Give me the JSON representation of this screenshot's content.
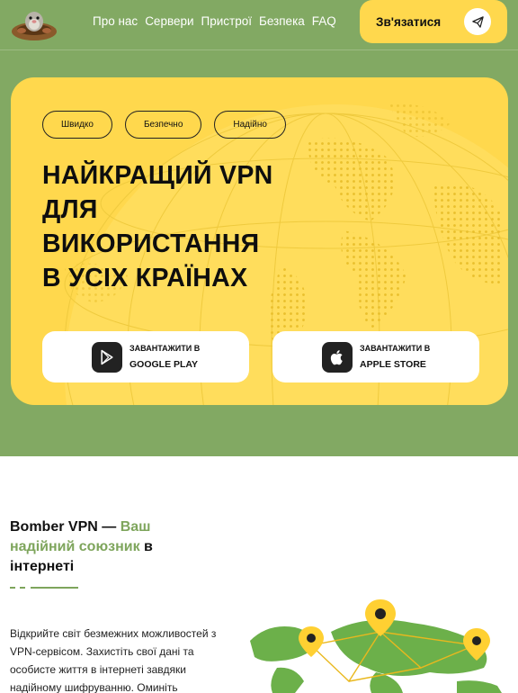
{
  "nav": {
    "items": [
      "Про нас",
      "Сервери",
      "Пристрої",
      "Безпека",
      "FAQ"
    ],
    "contact_label": "Зв'язатися"
  },
  "hero": {
    "pills": [
      "Швидко",
      "Безпечно",
      "Надійно"
    ],
    "title_lines": [
      "НАЙКРАЩИЙ VPN",
      "ДЛЯ",
      "ВИКОРИСТАННЯ",
      "В УСІХ КРАЇНАХ"
    ],
    "google": {
      "line1": "ЗАВАНТАЖИТИ В",
      "line2": "GOOGLE PLAY"
    },
    "apple": {
      "line1": "ЗАВАНТАЖИТИ В",
      "line2": "APPLE STORE"
    }
  },
  "about": {
    "title_pre": "Bomber VPN — ",
    "title_highlight": "Ваш надійний союзник",
    "title_post": " в інтернеті",
    "text": "Відкрийте світ безмежних можливостей з VPN-сервісом. Захистіть свої дані та особисте життя в інтернеті завдяки надійному шифруванню. Оминіть"
  },
  "colors": {
    "green": "#82a963",
    "yellow": "#ffd84d",
    "accent_green": "#7ea55c"
  }
}
